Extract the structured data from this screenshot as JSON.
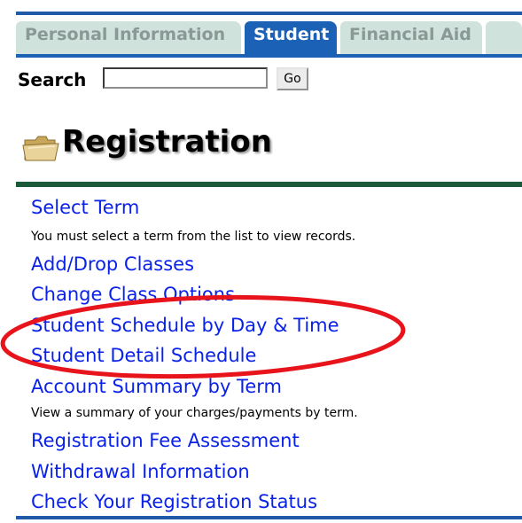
{
  "tabs": [
    {
      "label": "Personal Information",
      "active": false
    },
    {
      "label": "Student",
      "active": true
    },
    {
      "label": "Financial Aid",
      "active": false
    }
  ],
  "search": {
    "label": "Search",
    "value": "",
    "button_label": "Go"
  },
  "page": {
    "title": "Registration",
    "icon": "folder-icon"
  },
  "menu": [
    {
      "label": "Select Term",
      "description": "You must select a term from the list to view records."
    },
    {
      "label": "Add/Drop Classes"
    },
    {
      "label": "Change Class Options"
    },
    {
      "label": "Student Schedule by Day & Time"
    },
    {
      "label": "Student Detail Schedule"
    },
    {
      "label": "Account Summary by Term",
      "description": "View a summary of your charges/payments by term."
    },
    {
      "label": "Registration Fee Assessment"
    },
    {
      "label": "Withdrawal Information"
    },
    {
      "label": "Check Your Registration Status"
    }
  ],
  "colors": {
    "tab_active": "#1b61b6",
    "tab_inactive": "#cfe2dc",
    "link": "#0a22e8",
    "title_rule": "#1a5a3a",
    "annotation": "#e8141c"
  }
}
